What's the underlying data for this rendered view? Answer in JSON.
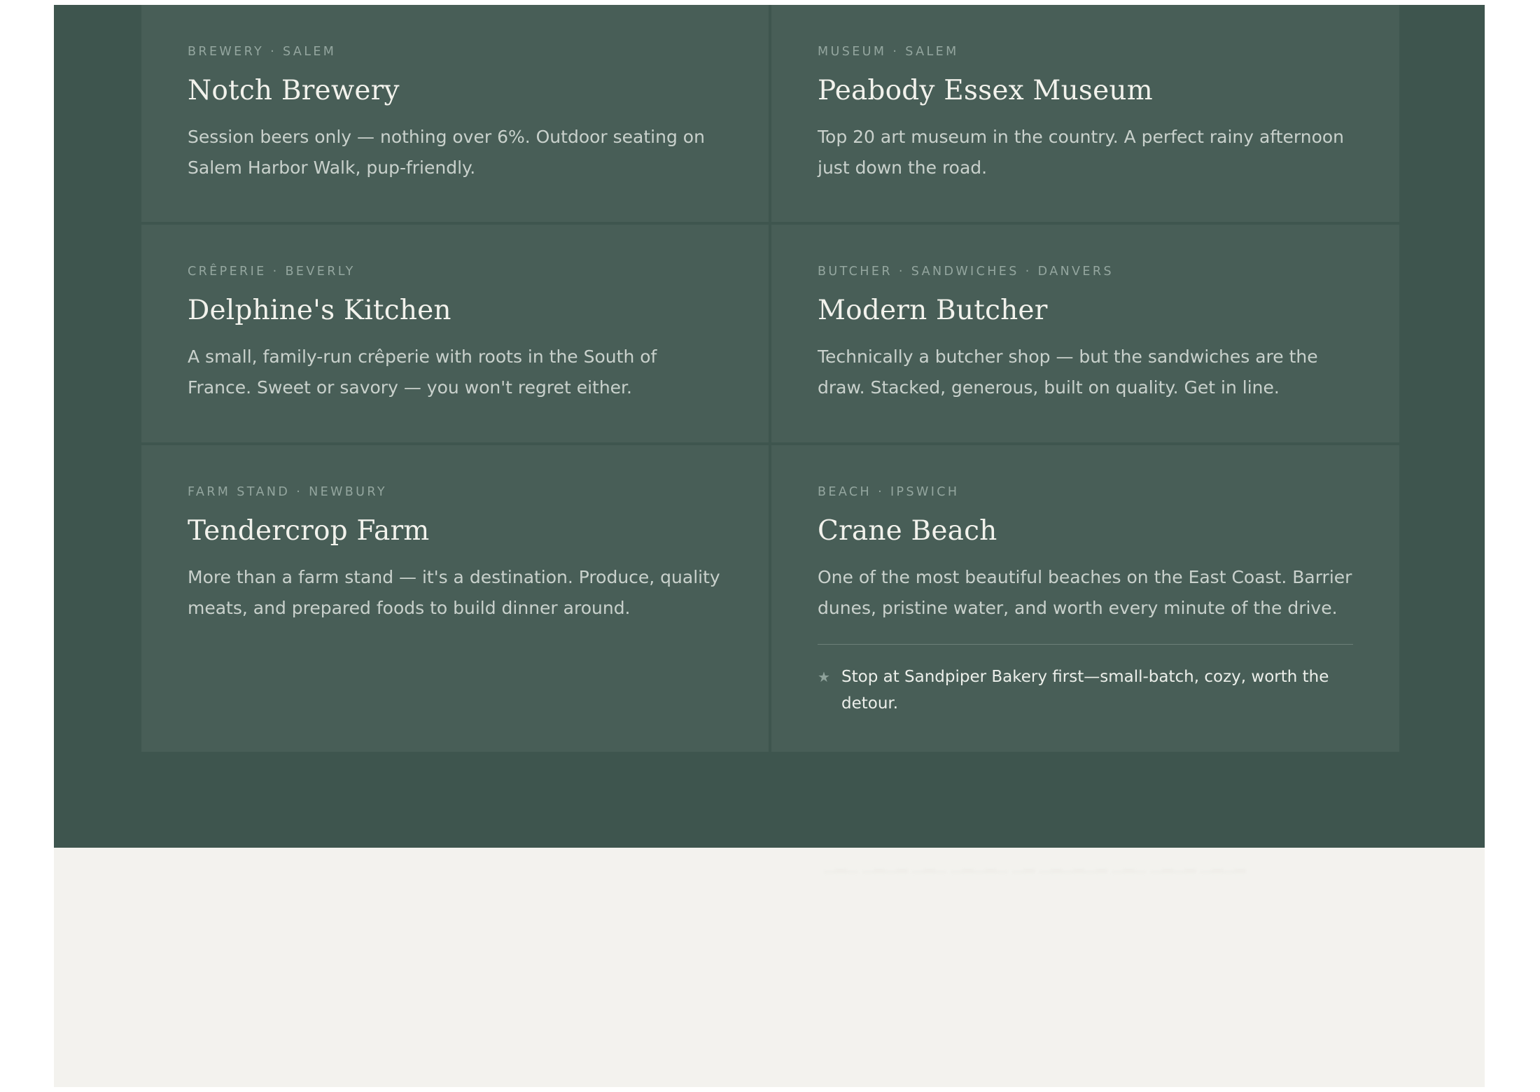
{
  "cards": [
    {
      "meta": "BREWERY · SALEM",
      "title": "Notch Brewery",
      "description": "Session beers only — nothing over 6%. Outdoor seating on Salem Harbor Walk, pup-friendly."
    },
    {
      "meta": "MUSEUM · SALEM",
      "title": "Peabody Essex Museum",
      "description": "Top 20 art museum in the country. A perfect rainy afternoon just down the road."
    },
    {
      "meta": "CRÊPERIE · BEVERLY",
      "title": "Delphine's Kitchen",
      "description": "A small, family-run crêperie with roots in the South of France. Sweet or savory — you won't regret either."
    },
    {
      "meta": "BUTCHER · SANDWICHES · DANVERS",
      "title": "Modern Butcher",
      "description": "Technically a butcher shop — but the sandwiches are the draw. Stacked, generous, built on quality. Get in line."
    },
    {
      "meta": "FARM STAND · NEWBURY",
      "title": "Tendercrop Farm",
      "description": "More than a farm stand — it's a destination. Produce, quality meats, and prepared foods to build dinner around."
    },
    {
      "meta": "BEACH · IPSWICH",
      "title": "Crane Beach",
      "description": "One of the most beautiful beaches on the East Coast. Barrier dunes, pristine water, and worth every minute of the drive.",
      "tip": "Stop at Sandpiper Bakery first—small-batch, cozy, worth the detour."
    }
  ],
  "colors": {
    "section_bg": "#3e554e",
    "card_bg": "#485e57",
    "page_bg": "#f3f2ee",
    "title_text": "#f2f2ec",
    "body_text": "#c9d1cc",
    "meta_text": "#94a69f"
  },
  "icons": {
    "tip": "star-icon"
  }
}
